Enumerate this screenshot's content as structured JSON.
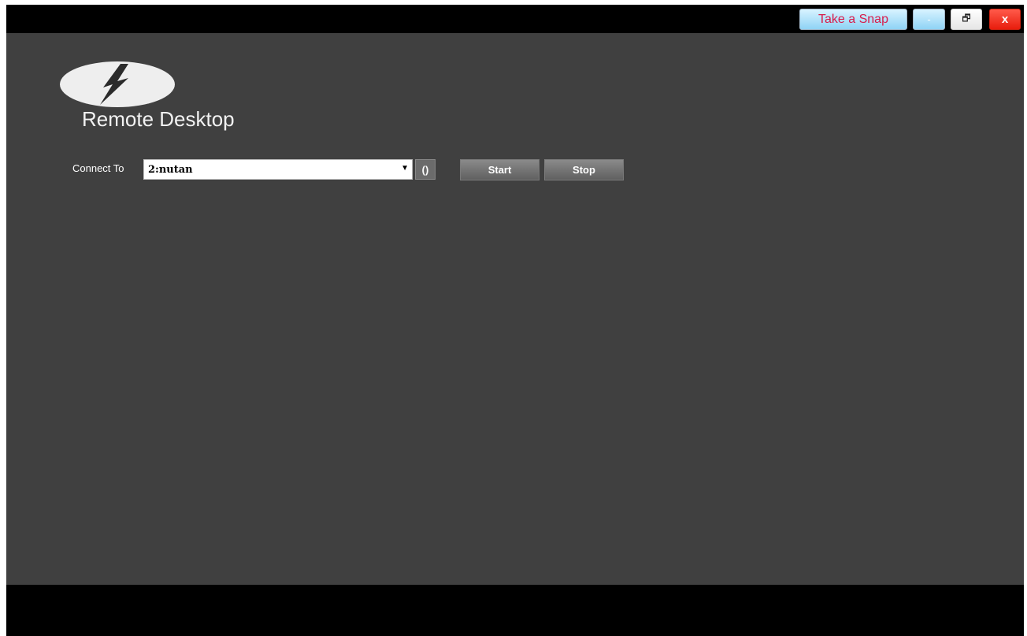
{
  "titlebar": {
    "snap_label": "Take a Snap",
    "minimize_glyph": "-",
    "restore_glyph": "🗗",
    "close_glyph": "x"
  },
  "app": {
    "title": "Remote Desktop",
    "logo_icon": "lightning-bolt-icon"
  },
  "connect": {
    "label": "Connect To",
    "selected_value": "2:nutan",
    "dropdown_glyph": "▼",
    "refresh_glyph": "()"
  },
  "actions": {
    "start_label": "Start",
    "stop_label": "Stop"
  },
  "colors": {
    "content_bg": "#404040",
    "frame_bg": "#000000",
    "snap_text": "#d81b4a",
    "close_bg": "#e81d0d"
  }
}
